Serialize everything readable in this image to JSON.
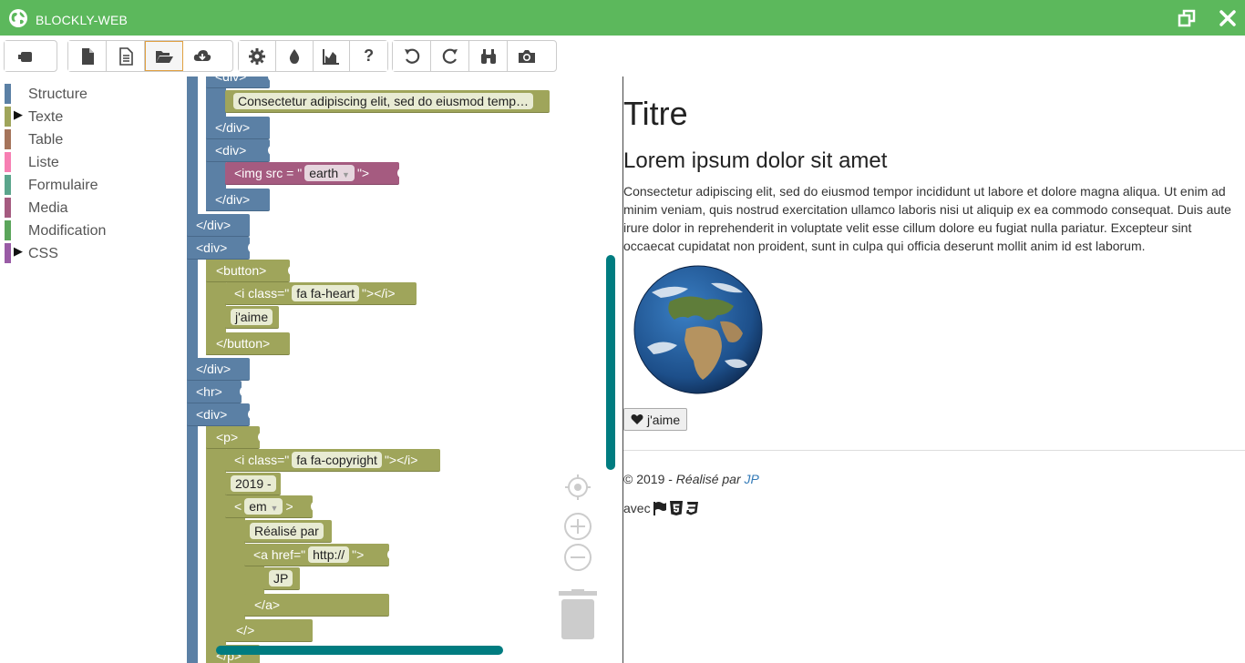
{
  "app": {
    "title": "BLOCKLY-WEB",
    "colors": {
      "titlebar": "#5cb85c",
      "scrollbar": "#007c80"
    }
  },
  "toolbar": {
    "buttons": [
      {
        "icon": "toggle-icon"
      },
      {
        "icon": "new-file-icon"
      },
      {
        "icon": "file-text-icon"
      },
      {
        "icon": "folder-open-icon",
        "active": true
      },
      {
        "icon": "cloud-download-icon"
      },
      {
        "icon": "gear-icon"
      },
      {
        "icon": "tint-icon"
      },
      {
        "icon": "chart-icon"
      },
      {
        "icon": "help-icon",
        "label": "?"
      },
      {
        "icon": "undo-icon"
      },
      {
        "icon": "redo-icon"
      },
      {
        "icon": "binoculars-icon"
      },
      {
        "icon": "camera-icon"
      }
    ]
  },
  "toolbox": {
    "categories": [
      {
        "label": "Structure",
        "color": "#5b80a5",
        "expandable": false
      },
      {
        "label": "Texte",
        "color": "#9fa55b",
        "expandable": true
      },
      {
        "label": "Table",
        "color": "#a5745b",
        "expandable": false
      },
      {
        "label": "Liste",
        "color": "#f77fb3",
        "expandable": false
      },
      {
        "label": "Formulaire",
        "color": "#5ba58c",
        "expandable": false
      },
      {
        "label": "Media",
        "color": "#a55b80",
        "expandable": false
      },
      {
        "label": "Modification",
        "color": "#5ba55b",
        "expandable": false
      },
      {
        "label": "CSS",
        "color": "#995ba5",
        "expandable": true
      }
    ]
  },
  "workspace": {
    "blocks": {
      "b_div_top": "<div>",
      "b_text1": "Consectetur adipiscing elit, sed do eiusmod temp…",
      "b_close1": "</div>",
      "b_div2": "<div>",
      "b_img_pre": "<img src = \"",
      "b_img_field": "earth",
      "b_img_post": "\">",
      "b_close2": "</div>",
      "b_close3": "</div>",
      "b_div3": "<div>",
      "b_button": "<button>",
      "b_i_pre": "<i class=\"",
      "b_i_field": "fa fa-heart",
      "b_i_post": "\"></i>",
      "b_jaime": "j'aime",
      "b_button_close": "</button>",
      "b_close4": "</div>",
      "b_hr": "<hr>",
      "b_div4": "<div>",
      "b_p": "<p>",
      "b_i2_pre": "<i class=\"",
      "b_i2_field": "fa fa-copyright",
      "b_i2_post": "\"></i>",
      "b_year": "2019 -",
      "b_em_pre": "<",
      "b_em_field": "em",
      "b_em_post": ">",
      "b_realise": "Réalisé par",
      "b_a_pre": "<a href=\"",
      "b_a_field": "http://",
      "b_a_post": "\">",
      "b_jp": "JP",
      "b_a_close": "</a>",
      "b_slash": "</>",
      "b_cut": "</p>"
    }
  },
  "preview": {
    "h1": "Titre",
    "h2": "Lorem ipsum dolor sit amet",
    "paragraph": "Consectetur adipiscing elit, sed do eiusmod tempor incididunt ut labore et dolore magna aliqua. Ut enim ad minim veniam, quis nostrud exercitation ullamco laboris nisi ut aliquip ex ea commodo consequat. Duis aute irure dolor in reprehenderit in voluptate velit esse cillum dolore eu fugiat nulla pariatur. Excepteur sint occaecat cupidatat non proident, sunt in culpa qui officia deserunt mollit anim id est laborum.",
    "button_label": "j'aime",
    "footer_copyright": "© 2019 - ",
    "footer_realise": "Réalisé par ",
    "footer_link": "JP",
    "avec": "avec"
  }
}
